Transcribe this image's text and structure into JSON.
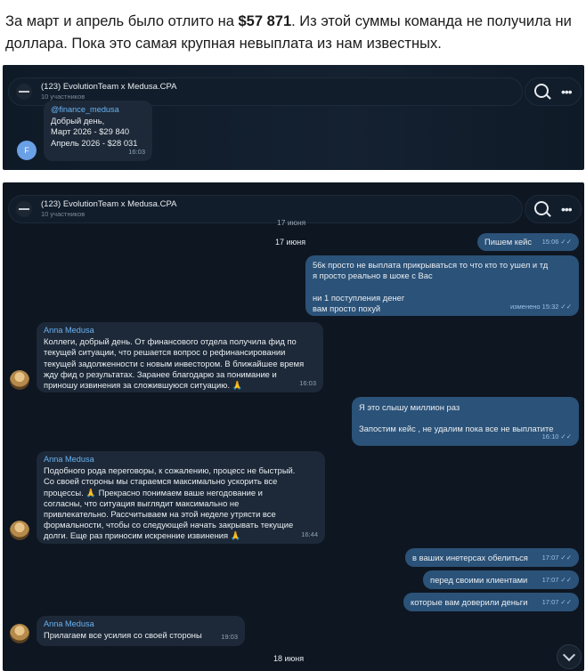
{
  "intro": {
    "part1": "За март и апрель было отлито на ",
    "amount": "$57 871",
    "part2": ". Из этой суммы команда не получила ни доллара. Пока это самая крупная невыплата из нам известных."
  },
  "chat_header": {
    "title": "(123) EvolutionTeam x Medusa.CPA",
    "members": "10 участников",
    "icons": [
      "search-icon",
      "more-icon"
    ]
  },
  "screenshot1": {
    "avatar_letter": "F",
    "message": {
      "sender": "@finance_medusa",
      "lines": [
        "Добрый день,",
        "Март 2026 - $29 840",
        "Апрель 2026 - $28 031"
      ],
      "time": "16:03"
    }
  },
  "screenshot2": {
    "date_top": "17 июня",
    "date_sticky": "17 июня",
    "date_bottom": "18 июня",
    "messages": [
      {
        "dir": "out",
        "lines": [
          "Пишем кейс"
        ],
        "time": "15:06"
      },
      {
        "dir": "out",
        "lines": [
          "56к просто не выплата прикрываться то что кто то ушел и тд",
          "я просто реально в шоке с Вас",
          "",
          "ни 1 поступления денег",
          "вам просто похуй"
        ],
        "time": "изменено 15:32"
      },
      {
        "dir": "in",
        "sender": "Anna Medusa",
        "lines": [
          "Коллеги, добрый день. От финансового отдела получила фид по",
          "текущей ситуации, что решается вопрос о рефинансировании",
          "текущей задолженности с новым инвестором. В ближайшее время",
          "жду фид о результатах. Заранее благодарю за понимание и",
          "приношу извинения за сложившуюся ситуацию. 🙏"
        ],
        "time": "16:03"
      },
      {
        "dir": "out",
        "lines": [
          "Я это слышу миллион раз",
          "",
          "Запостим кейс , не удалим пока все не выплатите"
        ],
        "time": "16:10"
      },
      {
        "dir": "in",
        "sender": "Anna Medusa",
        "lines": [
          "Подобного рода переговоры, к сожалению, процесс не быстрый.",
          "Со своей стороны мы стараемся максимально ускорить все",
          "процессы. 🙏 Прекрасно понимаем ваше негодование и",
          "согласны, что ситуация выглядит максимально не",
          "привлекательно. Рассчитываем на этой неделе утрясти все",
          "формальности, чтобы со следующей начать закрывать текущие",
          "долги. Еще раз приносим искренние извинения 🙏"
        ],
        "time": "16:44"
      },
      {
        "dir": "out",
        "lines": [
          "в ваших инетерсах обелиться"
        ],
        "time": "17:07"
      },
      {
        "dir": "out",
        "lines": [
          "перед своими клиентами"
        ],
        "time": "17:07"
      },
      {
        "dir": "out",
        "lines": [
          "которые вам доверили деньги"
        ],
        "time": "17:07"
      },
      {
        "dir": "in",
        "sender": "Anna Medusa",
        "lines": [
          "Прилагаем все усилия со своей стороны"
        ],
        "time": "19:03"
      }
    ]
  }
}
